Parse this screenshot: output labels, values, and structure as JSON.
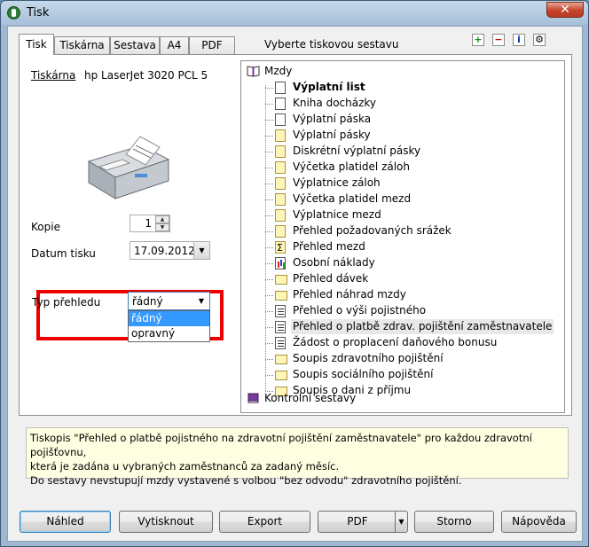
{
  "window": {
    "title": "Tisk",
    "close_label": "✕"
  },
  "tabs": [
    {
      "label": "Tisk"
    },
    {
      "label": "Tiskárna"
    },
    {
      "label": "Sestava"
    },
    {
      "label": "A4"
    },
    {
      "label": "PDF"
    }
  ],
  "tab_hint": "Vyberte tiskovou sestavu",
  "toolbar": {
    "expand": "+",
    "collapse": "−",
    "info": "i",
    "settings": "⚙"
  },
  "printer": {
    "label": "Tiskárna",
    "name": "hp LaserJet 3020 PCL 5"
  },
  "copies": {
    "label": "Kopie",
    "value": "1"
  },
  "print_date": {
    "label": "Datum tisku",
    "value": "17.09.2012"
  },
  "overview_type": {
    "label": "Typ přehledu",
    "value": "řádný",
    "options": [
      "řádný",
      "opravný"
    ]
  },
  "tree": {
    "root": "Mzdy",
    "items": [
      {
        "label": "Výplatní list",
        "icon": "doc",
        "bold": true
      },
      {
        "label": "Kniha docházky",
        "icon": "doc"
      },
      {
        "label": "Výplatní páska",
        "icon": "doc"
      },
      {
        "label": "Výplatní pásky",
        "icon": "doc-yellow"
      },
      {
        "label": "Diskrétní výplatní pásky",
        "icon": "doc-yellow"
      },
      {
        "label": "Výčetka platidel záloh",
        "icon": "doc-yellow"
      },
      {
        "label": "Výplatnice záloh",
        "icon": "doc-yellow"
      },
      {
        "label": "Výčetka platidel mezd",
        "icon": "doc-yellow"
      },
      {
        "label": "Výplatnice mezd",
        "icon": "doc-yellow"
      },
      {
        "label": "Přehled požadovaných srážek",
        "icon": "doc-yellow"
      },
      {
        "label": "Přehled mezd",
        "icon": "sum"
      },
      {
        "label": "Osobní náklady",
        "icon": "chart"
      },
      {
        "label": "Přehled dávek",
        "icon": "folder"
      },
      {
        "label": "Přehled náhrad mzdy",
        "icon": "folder"
      },
      {
        "label": "Přehled o výši pojistného",
        "icon": "lines"
      },
      {
        "label": "Přehled o platbě zdrav. pojištění zaměstnavatele",
        "icon": "lines",
        "selected": true
      },
      {
        "label": "Žádost o proplacení daňového bonusu",
        "icon": "lines"
      },
      {
        "label": "Soupis zdravotního pojištění",
        "icon": "folder"
      },
      {
        "label": "Soupis sociálního pojištění",
        "icon": "folder"
      },
      {
        "label": "Soupis o dani z příjmu",
        "icon": "folder"
      }
    ],
    "footer": "Kontrolní sestavy"
  },
  "description": {
    "line1": "Tiskopis \"Přehled o platbě pojistného na zdravotní pojištění zaměstnavatele\" pro každou zdravotní pojišťovnu,",
    "line2": "která je zadána u vybraných zaměstnanců za zadaný měsíc.",
    "line3": "Do sestavy nevstupují mzdy vystavené s volbou \"bez odvodu\" zdravotního pojištění."
  },
  "buttons": {
    "preview": "Náhled",
    "print": "Vytisknout",
    "export": "Export",
    "pdf": "PDF",
    "cancel": "Storno",
    "help": "Nápověda"
  },
  "colors": {
    "highlight": "#ee0000",
    "selection": "#3399ff",
    "desc_bg": "#fefee1"
  }
}
